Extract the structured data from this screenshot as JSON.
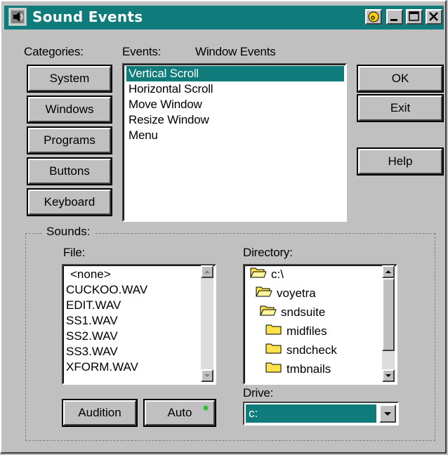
{
  "window": {
    "title": "Sound Events"
  },
  "labels": {
    "categories": "Categories:",
    "events": "Events:",
    "event_group": "Window Events",
    "sounds": "Sounds:",
    "file": "File:",
    "directory": "Directory:",
    "drive": "Drive:"
  },
  "categories": [
    "System",
    "Windows",
    "Programs",
    "Buttons",
    "Keyboard"
  ],
  "events": {
    "items": [
      "Vertical Scroll",
      "Horizontal Scroll",
      "Move Window",
      "Resize Window",
      "Menu"
    ],
    "selected": "Vertical Scroll"
  },
  "actions": {
    "ok": "OK",
    "exit": "Exit",
    "help": "Help"
  },
  "files": [
    "<none>",
    "CUCKOO.WAV",
    "EDIT.WAV",
    "SS1.WAV",
    "SS2.WAV",
    "SS3.WAV",
    "XFORM.WAV"
  ],
  "directories": [
    {
      "name": "c:\\",
      "icon": "open-folder-icon"
    },
    {
      "name": "voyetra",
      "icon": "open-folder-icon"
    },
    {
      "name": "sndsuite",
      "icon": "open-folder-icon"
    },
    {
      "name": "midfiles",
      "icon": "folder-icon"
    },
    {
      "name": "sndcheck",
      "icon": "folder-icon"
    },
    {
      "name": "tmbnails",
      "icon": "folder-icon"
    }
  ],
  "drive": {
    "value": "c:"
  },
  "bottom_buttons": {
    "audition": "Audition",
    "auto": "Auto"
  },
  "colors": {
    "titlebar": "#0f7b7b",
    "selection": "#0f7b7b",
    "face": "#c0c0c0",
    "auto_led": "#2ec22e"
  }
}
